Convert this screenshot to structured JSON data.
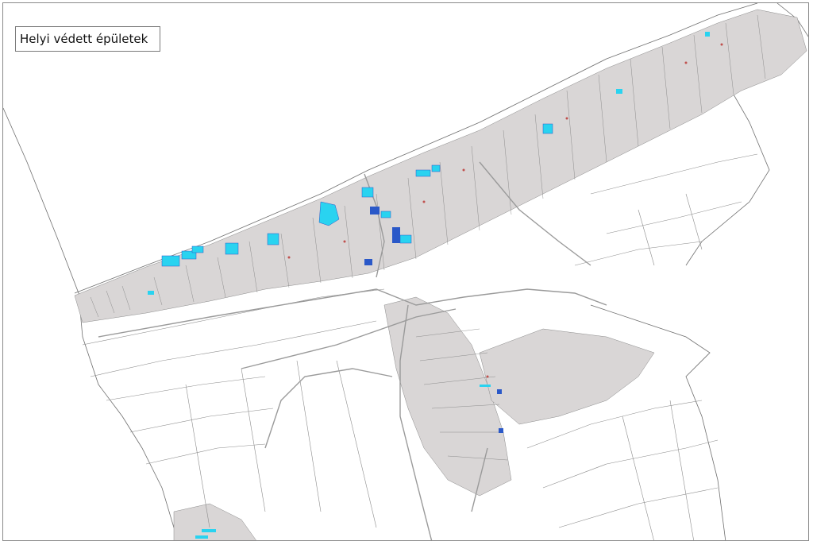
{
  "map": {
    "title": "Helyi védett épületek",
    "colors": {
      "background": "#ffffff",
      "parcel_line": "#6f6f6f",
      "parcel_dense": "#8a8a8a",
      "road": "#9a9a9a",
      "protected_building": "#29d3f0",
      "protected_building_dark": "#2a58c8",
      "building_marker": "#c0504d"
    },
    "layers": [
      "cadastral-parcels",
      "roads",
      "protected-buildings"
    ],
    "icons": [
      "map-title-box"
    ]
  }
}
